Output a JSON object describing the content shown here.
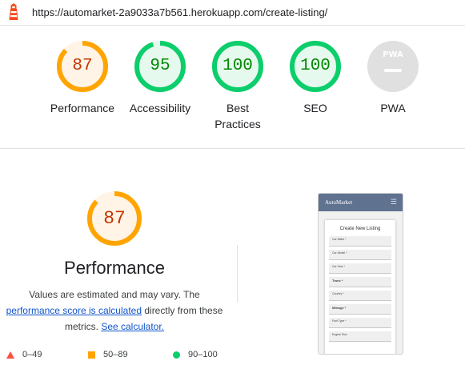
{
  "browser": {
    "url": "https://automarket-2a9033a7b561.herokuapp.com/create-listing/"
  },
  "colors": {
    "orange": "#ffa400",
    "green": "#0cce6b",
    "gray": "#e0e0e0",
    "red": "#ff4e42",
    "orange_text": "#c33300",
    "green_text": "#008800"
  },
  "gauges": [
    {
      "score": "87",
      "label": "Performance",
      "color": "orange"
    },
    {
      "score": "95",
      "label": "Accessibility",
      "color": "green"
    },
    {
      "score": "100",
      "label": "Best Practices",
      "color": "green"
    },
    {
      "score": "100",
      "label": "SEO",
      "color": "green"
    },
    {
      "score": "",
      "label": "PWA",
      "color": "gray",
      "badge": "PWA"
    }
  ],
  "performance": {
    "score": "87",
    "title": "Performance",
    "desc_line1": "Values are estimated and may vary. The",
    "desc_link1": "performance score is calculated",
    "desc_mid": " directly from these",
    "desc_pre2": "metrics. ",
    "desc_link2": "See calculator.",
    "legend": {
      "fail": "0–49",
      "average": "50–89",
      "pass": "90–100"
    }
  },
  "screenshot": {
    "brand": "AutoMarket",
    "card_title": "Create New Listing",
    "fields": [
      "Car Make *",
      "Car Model *",
      "Car Year *",
      "Trans *",
      "Country *",
      "Mileage *",
      "Fuel Type *",
      "Engine Size"
    ]
  }
}
